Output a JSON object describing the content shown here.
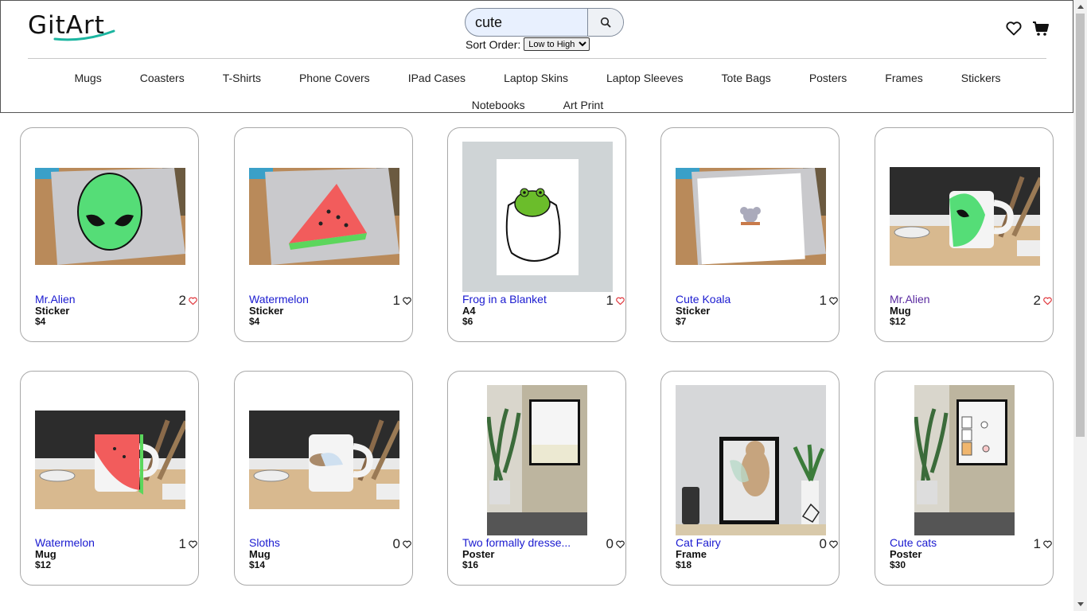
{
  "brand": {
    "logo_text": "GitArt"
  },
  "search": {
    "value": "cute",
    "icon": "search-icon"
  },
  "sort": {
    "label": "Sort Order:",
    "selected": "Low to High"
  },
  "header_icons": {
    "wishlist": "heart-icon",
    "cart": "cart-icon"
  },
  "nav": {
    "row1": [
      "Mugs",
      "Coasters",
      "T-Shirts",
      "Phone Covers",
      "IPad Cases",
      "Laptop Skins",
      "Laptop Sleeves",
      "Tote Bags",
      "Posters",
      "Frames",
      "Stickers"
    ],
    "row2": [
      "Notebooks",
      "Art Print"
    ]
  },
  "products": [
    {
      "name": "Mr.Alien",
      "type": "Sticker",
      "price": "$4",
      "likes": "2",
      "liked": true,
      "image": "alien-laptop-sticker"
    },
    {
      "name": "Watermelon",
      "type": "Sticker",
      "price": "$4",
      "likes": "1",
      "liked": false,
      "image": "watermelon-laptop-sticker"
    },
    {
      "name": "Frog in a Blanket",
      "type": "A4",
      "price": "$6",
      "likes": "1",
      "liked": true,
      "image": "frog-blanket-print"
    },
    {
      "name": "Cute Koala",
      "type": "Sticker",
      "price": "$7",
      "likes": "1",
      "liked": false,
      "image": "koala-laptop-sticker"
    },
    {
      "name": "Mr.Alien",
      "type": "Mug",
      "price": "$12",
      "likes": "2",
      "liked": true,
      "image": "alien-mug",
      "visited": true
    },
    {
      "name": "Watermelon",
      "type": "Mug",
      "price": "$12",
      "likes": "1",
      "liked": false,
      "image": "watermelon-mug"
    },
    {
      "name": "Sloths",
      "type": "Mug",
      "price": "$14",
      "likes": "0",
      "liked": false,
      "image": "sloth-mug"
    },
    {
      "name": "Two formally dresse...",
      "type": "Poster",
      "price": "$16",
      "likes": "0",
      "liked": false,
      "image": "poster-room"
    },
    {
      "name": "Cat Fairy",
      "type": "Frame",
      "price": "$18",
      "likes": "0",
      "liked": false,
      "image": "cat-fairy-frame"
    },
    {
      "name": "Cute cats",
      "type": "Poster",
      "price": "$30",
      "likes": "1",
      "liked": false,
      "image": "cats-poster"
    }
  ],
  "colors": {
    "link": "#1a1ad0",
    "visited_link": "#5a2aa0",
    "heart_liked": "#e0383e",
    "search_bg": "#e8f0fe"
  }
}
